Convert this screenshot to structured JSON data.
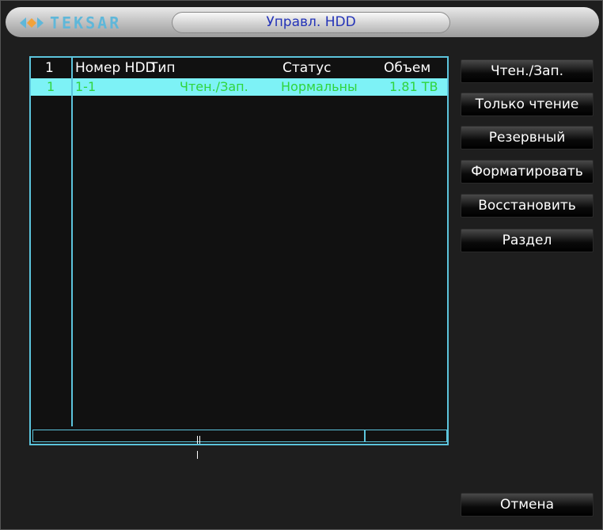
{
  "window": {
    "brand": "TEKSAR",
    "title": "Управл. HDD"
  },
  "table": {
    "columns": {
      "index": "1",
      "hdd_number": "Номер HDD",
      "type": "Тип",
      "status": "Статус",
      "size": "Объем"
    },
    "rows": [
      {
        "index": "1",
        "hdd_number": "1-1",
        "type": "Чтен./Зап.",
        "status": "Нормальны",
        "size": "1.81 TB"
      }
    ]
  },
  "buttons": {
    "read_write": "Чтен./Зап.",
    "read_only": "Только чтение",
    "backup": "Резервный",
    "format": "Форматировать",
    "restore": "Восстановить",
    "partition": "Раздел",
    "cancel": "Отмена"
  },
  "colors": {
    "accent_border": "#5cc4dc",
    "selected_row": "#7df2f6",
    "row_text": "#2fd53d",
    "title_text": "#2433b8"
  }
}
